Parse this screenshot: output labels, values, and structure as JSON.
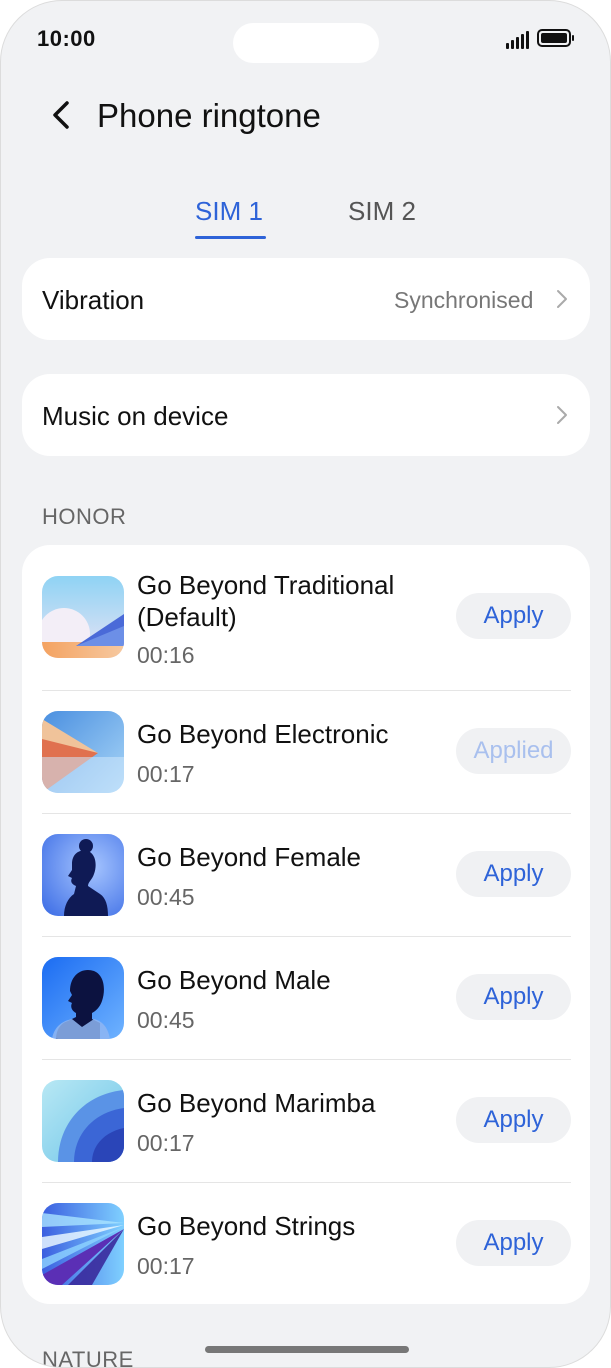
{
  "status_bar": {
    "time": "10:00"
  },
  "header": {
    "title": "Phone ringtone"
  },
  "tabs": [
    {
      "label": "SIM 1",
      "active": true
    },
    {
      "label": "SIM 2",
      "active": false
    }
  ],
  "vibration": {
    "label": "Vibration",
    "value": "Synchronised"
  },
  "music_on_device": {
    "label": "Music on device"
  },
  "sections": {
    "honor": "HONOR",
    "nature": "NATURE"
  },
  "songs": [
    {
      "title": "Go Beyond Traditional (Default)",
      "duration": "00:16",
      "action": "Apply",
      "applied": false,
      "icon": "landscape-pastel-icon"
    },
    {
      "title": "Go Beyond Electronic",
      "duration": "00:17",
      "action": "Applied",
      "applied": true,
      "icon": "geometric-electronic-icon"
    },
    {
      "title": "Go Beyond Female",
      "duration": "00:45",
      "action": "Apply",
      "applied": false,
      "icon": "female-silhouette-icon"
    },
    {
      "title": "Go Beyond Male",
      "duration": "00:45",
      "action": "Apply",
      "applied": false,
      "icon": "male-silhouette-icon"
    },
    {
      "title": "Go Beyond Marimba",
      "duration": "00:17",
      "action": "Apply",
      "applied": false,
      "icon": "marimba-arc-icon"
    },
    {
      "title": "Go Beyond Strings",
      "duration": "00:17",
      "action": "Apply",
      "applied": false,
      "icon": "strings-rays-icon"
    }
  ],
  "colors": {
    "accent": "#2e63d8",
    "applied_text": "#a9c0ee",
    "background": "#f1f2f4"
  }
}
